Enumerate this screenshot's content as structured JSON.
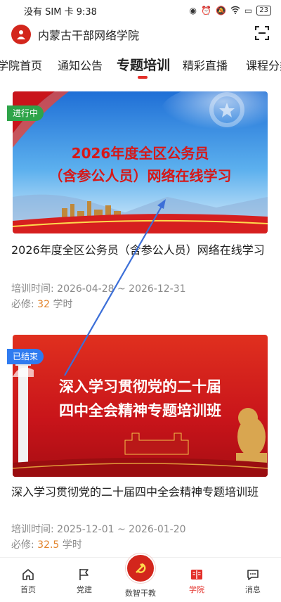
{
  "status_bar": {
    "carrier_time": "没有 SIM 卡 9:38",
    "battery": "23"
  },
  "header": {
    "title": "内蒙古干部网络学院"
  },
  "tabs": [
    "学院首页",
    "通知公告",
    "专题培训",
    "精彩直播",
    "课程分类"
  ],
  "active_tab": "专题培训",
  "cards": [
    {
      "badge": "进行中",
      "banner_line1": "2026年度全区公务员",
      "banner_line2": "（含参公人员）网络在线学习",
      "title": "2026年度全区公务员（含参公人员）网络在线学习",
      "period_label": "培训时间:",
      "period": "2026-04-28 ~ 2026-12-31",
      "required_label": "必修:",
      "hours": "32",
      "hours_unit": "学时"
    },
    {
      "badge": "已结束",
      "banner_line1": "深入学习贯彻党的二十届",
      "banner_line2": "四中全会精神专题培训班",
      "title": "深入学习贯彻党的二十届四中全会精神专题培训班",
      "period_label": "培训时间:",
      "period": "2025-12-01 ~ 2026-01-20",
      "required_label": "必修:",
      "hours": "32.5",
      "hours_unit": "学时"
    }
  ],
  "bottom_nav": [
    {
      "label": "首页",
      "icon": "home-icon"
    },
    {
      "label": "党建",
      "icon": "flag-icon"
    },
    {
      "label": "数智干教",
      "icon": "party-emblem-icon"
    },
    {
      "label": "学院",
      "icon": "book-icon"
    },
    {
      "label": "消息",
      "icon": "message-icon"
    }
  ],
  "active_nav": "学院",
  "colors": {
    "accent": "#e3302a",
    "badge_green": "#2ea449",
    "badge_blue": "#2f7bf0",
    "hours": "#e2832b"
  }
}
